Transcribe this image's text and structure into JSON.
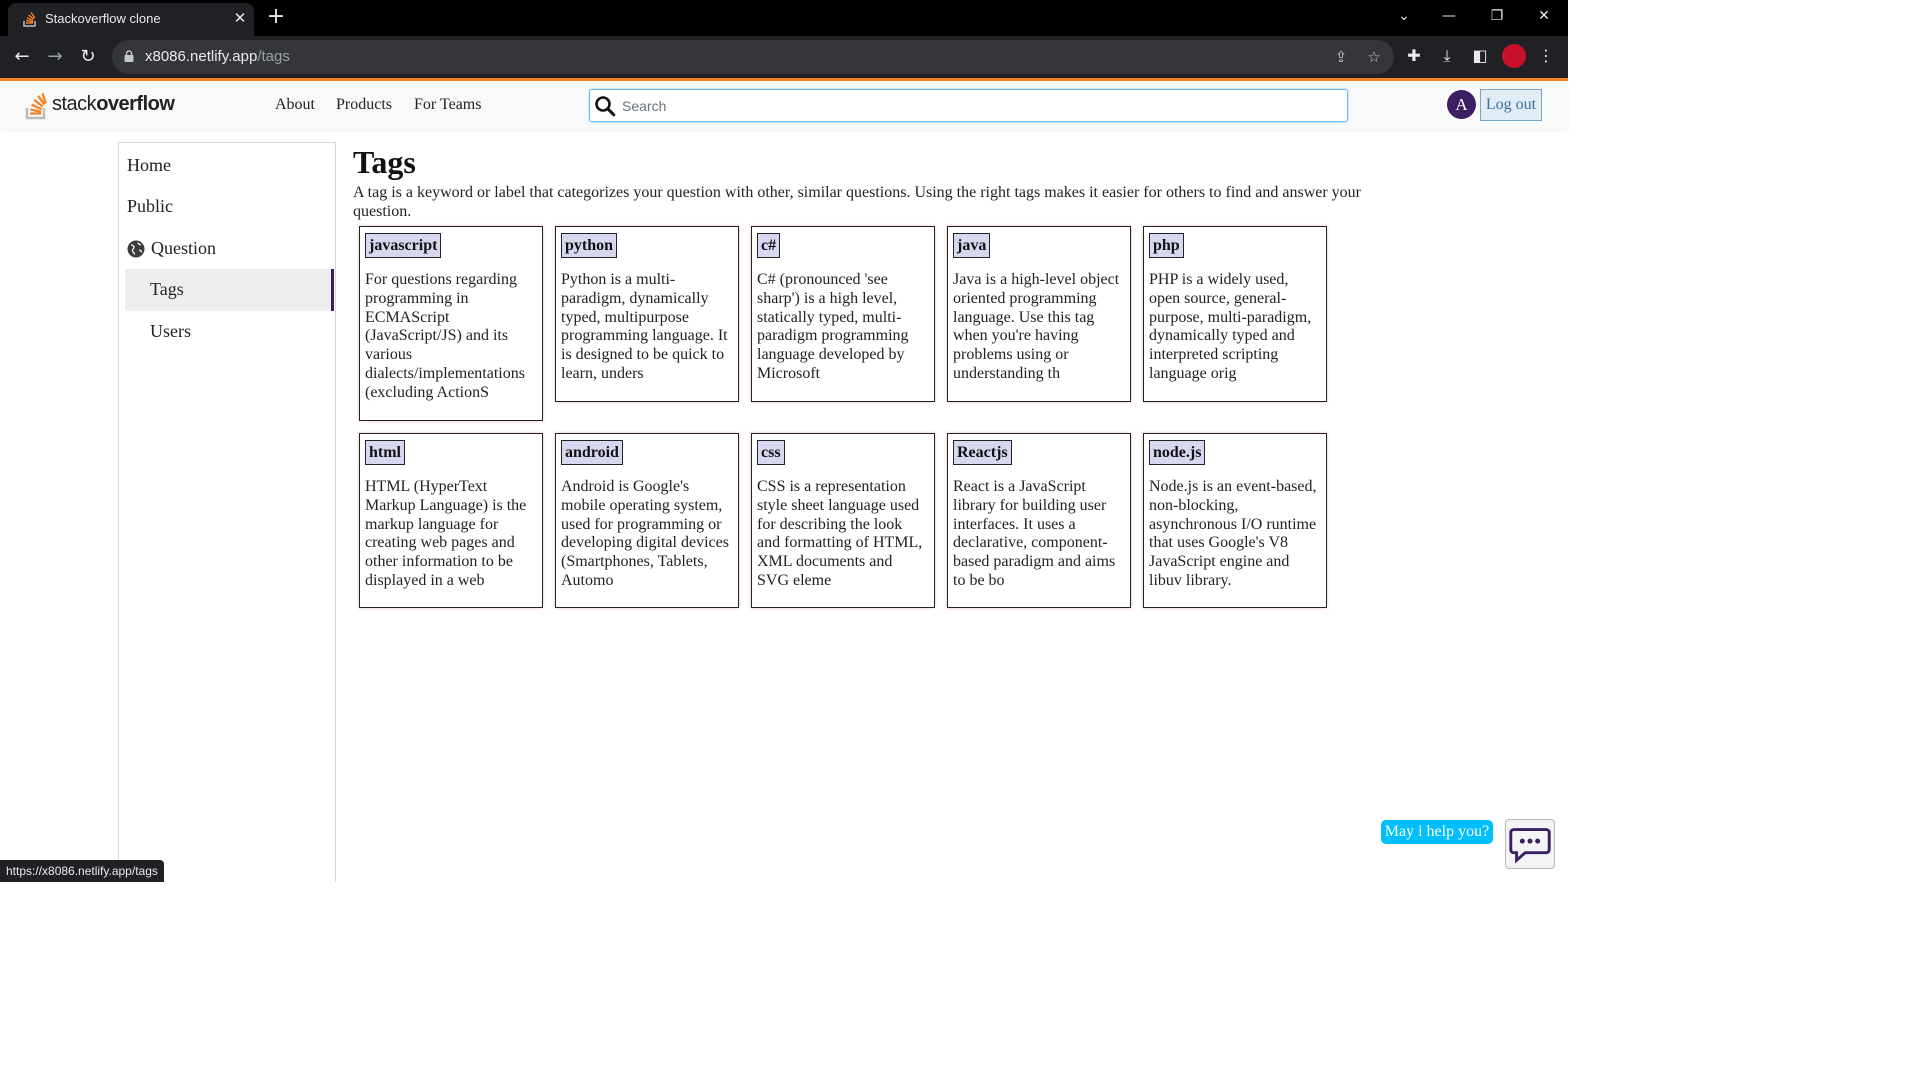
{
  "browser": {
    "tab_title": "Stackoverflow clone",
    "tab_close": "✕",
    "new_tab": "+",
    "url_host": "x8086.netlify.app",
    "url_path": "/tags",
    "status_url": "https://x8086.netlify.app/tags"
  },
  "header": {
    "logo_text_light": "stack",
    "logo_text_bold": "overflow",
    "nav": [
      "About",
      "Products",
      "For Teams"
    ],
    "search_placeholder": "Search",
    "avatar_letter": "A",
    "logout_label": "Log out"
  },
  "sidebar": {
    "items": [
      "Home",
      "Public",
      "Question",
      "Tags",
      "Users"
    ],
    "active": "Tags"
  },
  "main": {
    "title": "Tags",
    "description": "A tag is a keyword or label that categorizes your question with other, similar questions. Using the right tags makes it easier for others to find and answer your question."
  },
  "tags": [
    {
      "name": "javascript",
      "description": "For questions regarding programming in ECMAScript (JavaScript/JS) and its various dialects/implementations (excluding ActionS"
    },
    {
      "name": "python",
      "description": "Python is a multi-paradigm, dynamically typed, multipurpose programming language. It is designed to be quick to learn, unders"
    },
    {
      "name": "c#",
      "description": "C# (pronounced 'see sharp') is a high level, statically typed, multi-paradigm programming language developed by Microsoft"
    },
    {
      "name": "java",
      "description": "Java is a high-level object oriented programming language. Use this tag when you're having problems using or understanding th"
    },
    {
      "name": "php",
      "description": "PHP is a widely used, open source, general-purpose, multi-paradigm, dynamically typed and interpreted scripting language orig"
    },
    {
      "name": "html",
      "description": "HTML (HyperText Markup Language) is the markup language for creating web pages and other information to be displayed in a web"
    },
    {
      "name": "android",
      "description": "Android is Google's mobile operating system, used for programming or developing digital devices (Smartphones, Tablets, Automo"
    },
    {
      "name": "css",
      "description": "CSS is a representation style sheet language used for describing the look and formatting of HTML, XML documents and SVG eleme"
    },
    {
      "name": "Reactjs",
      "description": "React is a JavaScript library for building user interfaces. It uses a declarative, component-based paradigm and aims to be bo"
    },
    {
      "name": "node.js",
      "description": "Node.js is an event-based, non-blocking, asynchronous I/O runtime that uses Google's V8 JavaScript engine and libuv library."
    }
  ],
  "chat": {
    "help_text": "May i help you?"
  },
  "colors": {
    "accent_orange": "#f48024",
    "tag_chip_bg": "#d7d8f0",
    "avatar_bg": "#3b1e63",
    "help_bubble": "#00bfff"
  }
}
